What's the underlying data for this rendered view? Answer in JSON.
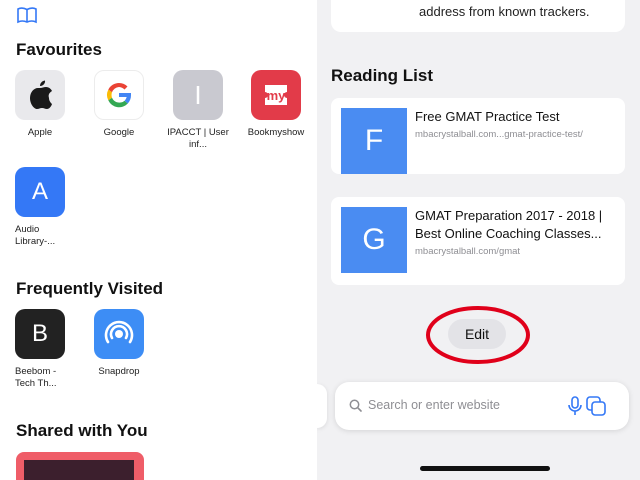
{
  "favourites": {
    "title": "Favourites",
    "items": [
      {
        "label": "Apple",
        "icon": "apple-logo-icon"
      },
      {
        "label": "Google",
        "icon": "google-logo-icon"
      },
      {
        "label": "IPACCT | User inf...",
        "letter": "I"
      },
      {
        "label": "Bookmyshow",
        "icon": "bookmyshow-logo-icon",
        "logo_text": "my"
      },
      {
        "label": "Audio Library-...",
        "letter": "A"
      }
    ]
  },
  "frequently_visited": {
    "title": "Frequently Visited",
    "items": [
      {
        "label": "Beebom - Tech Th...",
        "letter": "B"
      },
      {
        "label": "Snapdrop",
        "icon": "snapdrop-icon"
      }
    ]
  },
  "shared_with_you": {
    "title": "Shared with You"
  },
  "privacy": {
    "text": "address from known trackers."
  },
  "reading_list": {
    "title": "Reading List",
    "items": [
      {
        "letter": "F",
        "title": "Free GMAT Practice Test",
        "url": "mbacrystalball.com...gmat-practice-test/"
      },
      {
        "letter": "G",
        "title": "GMAT Preparation 2017 - 2018 | Best Online Coaching Classes...",
        "url": "mbacrystalball.com/gmat"
      }
    ],
    "edit_label": "Edit"
  },
  "search": {
    "placeholder": "Search or enter website"
  },
  "colors": {
    "accent": "#3478f6",
    "highlight_ring": "#e0001a"
  }
}
